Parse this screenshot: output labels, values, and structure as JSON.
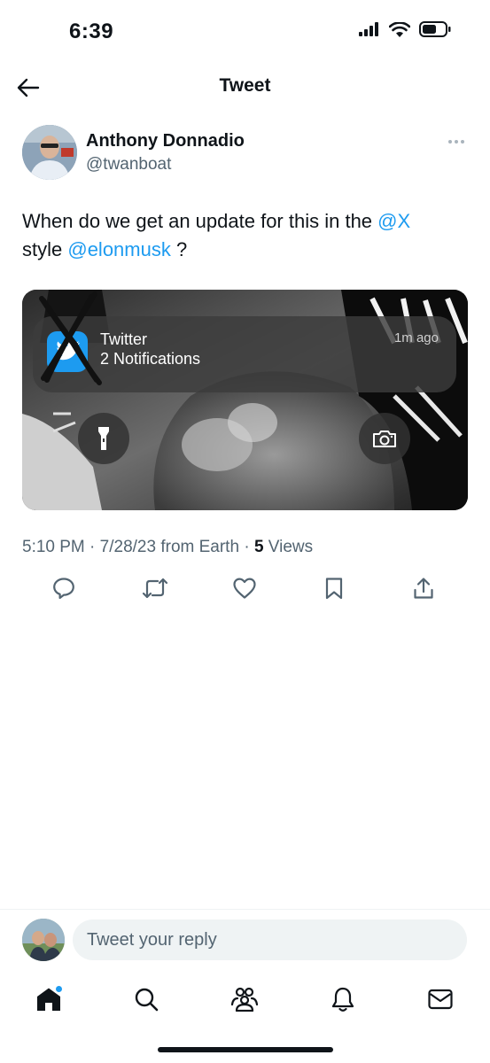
{
  "status_bar": {
    "time": "6:39"
  },
  "header": {
    "title": "Tweet"
  },
  "tweet": {
    "author_name": "Anthony Donnadio",
    "author_handle": "@twanboat",
    "text_part1": "When do we get an update for this in the ",
    "mention1": "@X",
    "text_part2": " style ",
    "mention2": "@elonmusk",
    "text_part3": " ?",
    "media": {
      "notification_app": "Twitter",
      "notification_body": "2 Notifications",
      "notification_time": "1m ago"
    },
    "time": "5:10 PM",
    "separator1": " · ",
    "date": "7/28/23",
    "source": " from Earth",
    "separator2": " · ",
    "views_count": "5",
    "views_label": " Views"
  },
  "actions": [
    "reply-icon",
    "retweet-icon",
    "like-icon",
    "bookmark-icon",
    "share-icon"
  ],
  "reply": {
    "placeholder": "Tweet your reply"
  },
  "tabs": [
    "home-icon",
    "search-icon",
    "communities-icon",
    "notifications-icon",
    "messages-icon"
  ],
  "colors": {
    "accent": "#1d9bf0",
    "text": "#0f1419",
    "secondary": "#536471"
  }
}
